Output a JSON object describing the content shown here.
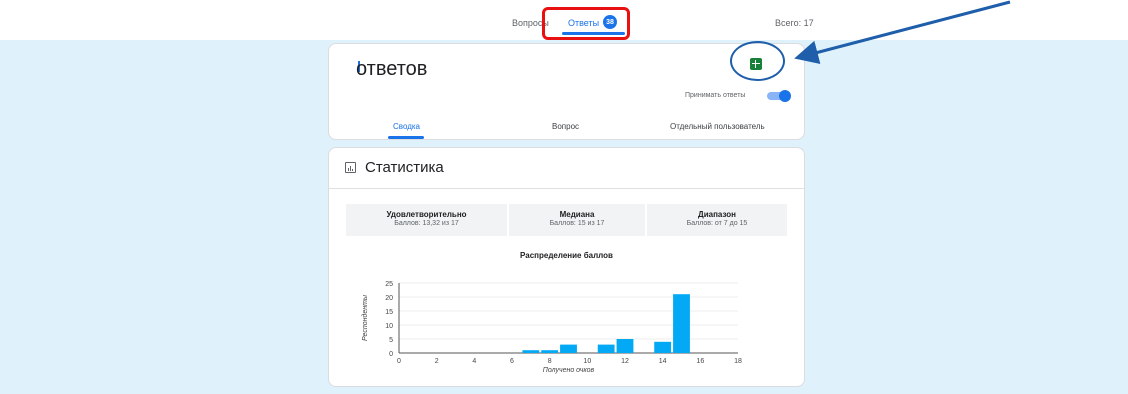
{
  "tabs": {
    "questions": "Вопросы",
    "answers": "Ответы",
    "answers_badge": "38"
  },
  "total": "Всего: 17",
  "responses_card": {
    "title": "ответов",
    "accept_label": "Принимать ответы",
    "accept_enabled": true,
    "subtabs": [
      "Сводка",
      "Вопрос",
      "Отдельный пользователь"
    ]
  },
  "stats": {
    "title": "Статистика",
    "boxes": [
      {
        "label": "Удовлетворительно",
        "value": "Баллов: 13,32 из 17"
      },
      {
        "label": "Медиана",
        "value": "Баллов: 15 из 17"
      },
      {
        "label": "Диапазон",
        "value": "Баллов: от 7 до 15"
      }
    ]
  },
  "icons": {
    "sheets": "sheets-icon",
    "stats": "bar-chart-icon"
  },
  "colors": {
    "accent": "#1a73e8",
    "sheets_green": "#188038",
    "background": "#dff2fb",
    "bar": "#03a9f4",
    "highlight_red": "#e81010",
    "annotation_blue": "#1e5eaa"
  },
  "chart_data": {
    "type": "bar",
    "title": "Распределение баллов",
    "xlabel": "Получено очков",
    "ylabel": "Респонденты",
    "x": [
      7,
      8,
      9,
      11,
      12,
      14,
      15
    ],
    "values": [
      1,
      1,
      3,
      3,
      5,
      4,
      21
    ],
    "xlim": [
      0,
      18
    ],
    "ylim": [
      0,
      25
    ],
    "xticks": [
      0,
      2,
      4,
      6,
      8,
      10,
      12,
      14,
      16,
      18
    ],
    "yticks": [
      0,
      5,
      10,
      15,
      20,
      25
    ],
    "grid": true,
    "color": "#03a9f4"
  }
}
